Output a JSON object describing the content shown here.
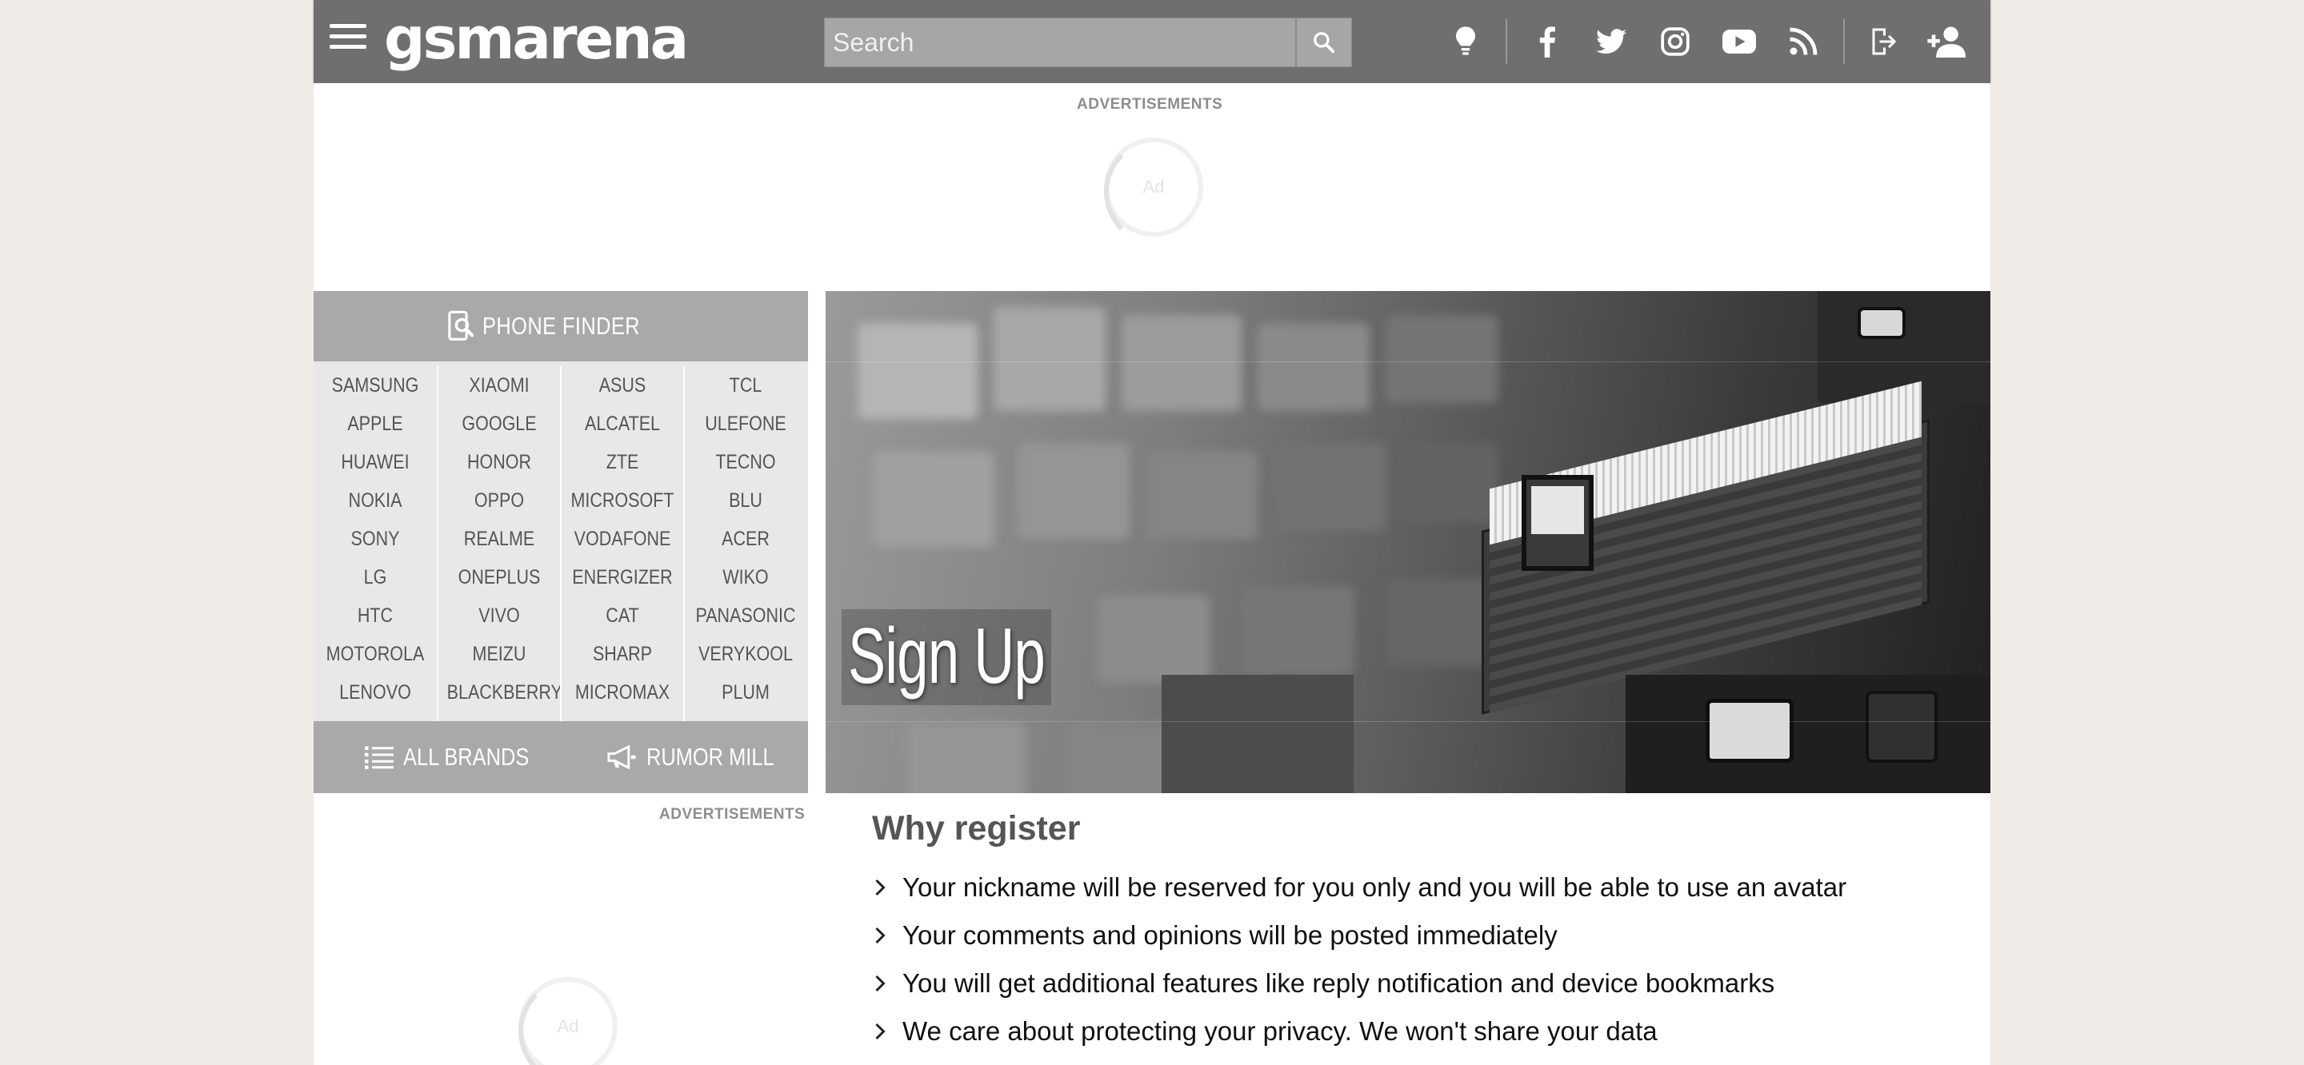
{
  "header": {
    "logo_text": "GSMArena",
    "search_placeholder": "Search",
    "icons": [
      "menu-icon",
      "search-icon",
      "lightbulb-icon",
      "facebook-icon",
      "twitter-icon",
      "instagram-icon",
      "youtube-icon",
      "rss-icon",
      "login-icon",
      "add-user-icon"
    ]
  },
  "ads": {
    "top_label": "ADVERTISEMENTS",
    "side_label": "ADVERTISEMENTS",
    "placeholder": "Ad"
  },
  "phone_finder": {
    "title": "PHONE FINDER",
    "columns": [
      [
        "SAMSUNG",
        "APPLE",
        "HUAWEI",
        "NOKIA",
        "SONY",
        "LG",
        "HTC",
        "MOTOROLA",
        "LENOVO"
      ],
      [
        "XIAOMI",
        "GOOGLE",
        "HONOR",
        "OPPO",
        "REALME",
        "ONEPLUS",
        "VIVO",
        "MEIZU",
        "BLACKBERRY"
      ],
      [
        "ASUS",
        "ALCATEL",
        "ZTE",
        "MICROSOFT",
        "VODAFONE",
        "ENERGIZER",
        "CAT",
        "SHARP",
        "MICROMAX"
      ],
      [
        "TCL",
        "ULEFONE",
        "TECNO",
        "BLU",
        "ACER",
        "WIKO",
        "PANASONIC",
        "VERYKOOL",
        "PLUM"
      ]
    ],
    "all_brands": "ALL BRANDS",
    "rumor_mill": "RUMOR MILL"
  },
  "hero": {
    "title": "Sign Up"
  },
  "why_register": {
    "title": "Why register",
    "reasons": [
      "Your nickname will be reserved for you only and you will be able to use an avatar",
      "Your comments and opinions will be posted immediately",
      "You will get additional features like reply notification and device bookmarks",
      "We care about protecting your privacy. We won't share your data"
    ]
  }
}
